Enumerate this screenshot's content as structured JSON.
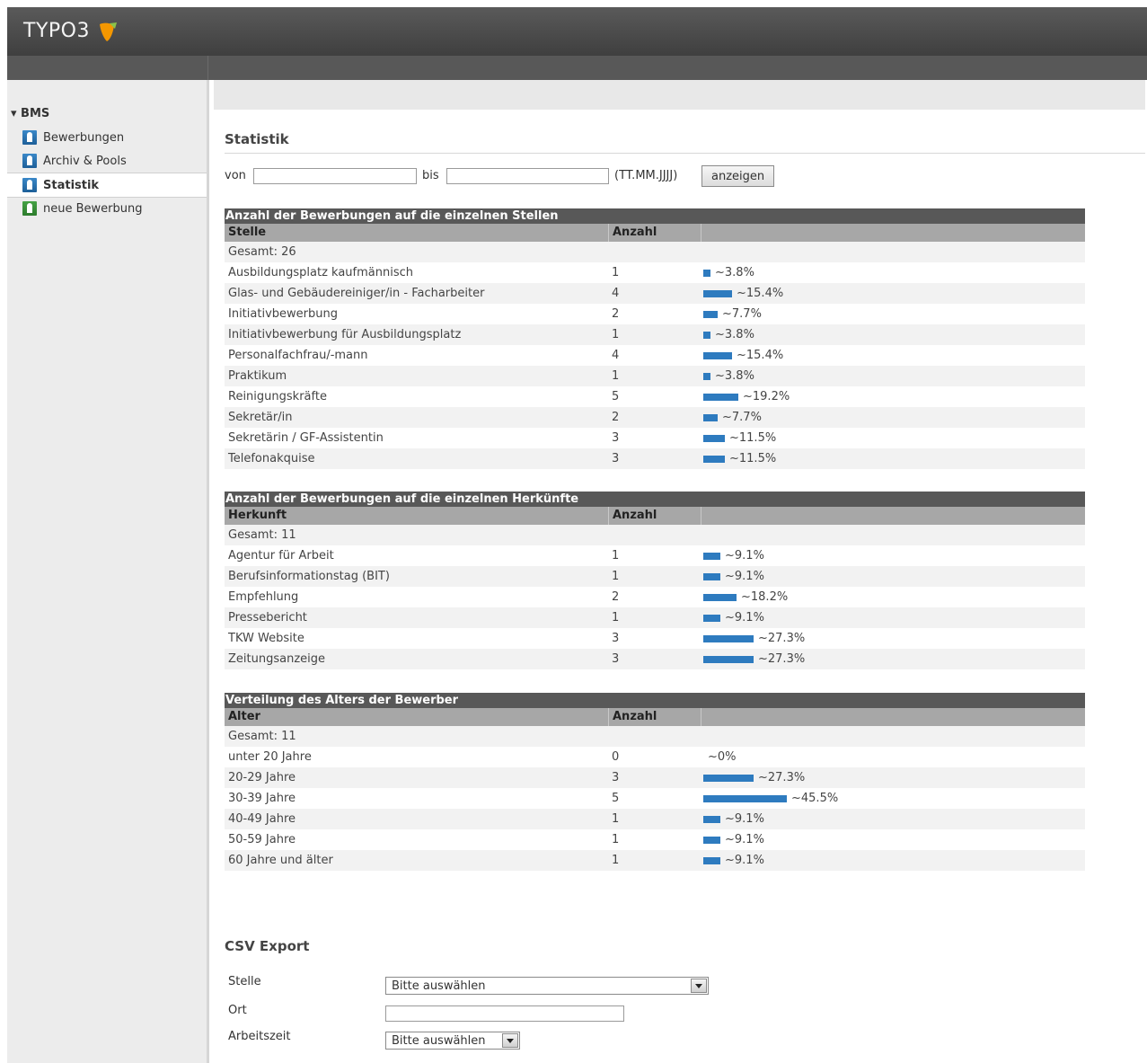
{
  "app": {
    "logo_text": "TYPO3"
  },
  "sidebar": {
    "group": "▾ BMS",
    "items": [
      {
        "label": "Bewerbungen",
        "icon": "user-icon"
      },
      {
        "label": "Archiv & Pools",
        "icon": "archive-user-icon"
      },
      {
        "label": "Statistik",
        "icon": "statistics-icon"
      },
      {
        "label": "neue Bewerbung",
        "icon": "add-user-icon"
      }
    ]
  },
  "main": {
    "title": "Statistik",
    "filter": {
      "from_label": "von",
      "from_value": "",
      "to_label": "bis",
      "to_value": "",
      "format_hint": "(TT.MM.JJJJ)",
      "submit_label": "anzeigen"
    },
    "tables": [
      {
        "title": "Anzahl der Bewerbungen auf die einzelnen Stellen",
        "col1": "Stelle",
        "col2": "Anzahl",
        "total": "Gesamt: 26",
        "rows": [
          {
            "label": "Ausbildungsplatz kaufmännisch",
            "count": "1",
            "pct": "~3.8%",
            "share": 0.038
          },
          {
            "label": "Glas- und Gebäudereiniger/in - Facharbeiter",
            "count": "4",
            "pct": "~15.4%",
            "share": 0.154
          },
          {
            "label": "Initiativbewerbung",
            "count": "2",
            "pct": "~7.7%",
            "share": 0.077
          },
          {
            "label": "Initiativbewerbung für Ausbildungsplatz",
            "count": "1",
            "pct": "~3.8%",
            "share": 0.038
          },
          {
            "label": "Personalfachfrau/-mann",
            "count": "4",
            "pct": "~15.4%",
            "share": 0.154
          },
          {
            "label": "Praktikum",
            "count": "1",
            "pct": "~3.8%",
            "share": 0.038
          },
          {
            "label": "Reinigungskräfte",
            "count": "5",
            "pct": "~19.2%",
            "share": 0.192
          },
          {
            "label": "Sekretär/in",
            "count": "2",
            "pct": "~7.7%",
            "share": 0.077
          },
          {
            "label": "Sekretärin / GF-Assistentin",
            "count": "3",
            "pct": "~11.5%",
            "share": 0.115
          },
          {
            "label": "Telefonakquise",
            "count": "3",
            "pct": "~11.5%",
            "share": 0.115
          }
        ]
      },
      {
        "title": "Anzahl der Bewerbungen auf die einzelnen Herkünfte",
        "col1": "Herkunft",
        "col2": "Anzahl",
        "total": "Gesamt: 11",
        "rows": [
          {
            "label": "Agentur für Arbeit",
            "count": "1",
            "pct": "~9.1%",
            "share": 0.091
          },
          {
            "label": "Berufsinformationstag (BIT)",
            "count": "1",
            "pct": "~9.1%",
            "share": 0.091
          },
          {
            "label": "Empfehlung",
            "count": "2",
            "pct": "~18.2%",
            "share": 0.182
          },
          {
            "label": "Pressebericht",
            "count": "1",
            "pct": "~9.1%",
            "share": 0.091
          },
          {
            "label": "TKW Website",
            "count": "3",
            "pct": "~27.3%",
            "share": 0.273
          },
          {
            "label": "Zeitungsanzeige",
            "count": "3",
            "pct": "~27.3%",
            "share": 0.273
          }
        ]
      },
      {
        "title": "Verteilung des Alters der Bewerber",
        "col1": "Alter",
        "col2": "Anzahl",
        "total": "Gesamt: 11",
        "rows": [
          {
            "label": "unter 20 Jahre",
            "count": "0",
            "pct": "~0%",
            "share": 0
          },
          {
            "label": "20-29 Jahre",
            "count": "3",
            "pct": "~27.3%",
            "share": 0.273
          },
          {
            "label": "30-39 Jahre",
            "count": "5",
            "pct": "~45.5%",
            "share": 0.455
          },
          {
            "label": "40-49 Jahre",
            "count": "1",
            "pct": "~9.1%",
            "share": 0.091
          },
          {
            "label": "50-59 Jahre",
            "count": "1",
            "pct": "~9.1%",
            "share": 0.091
          },
          {
            "label": "60 Jahre und älter",
            "count": "1",
            "pct": "~9.1%",
            "share": 0.091
          }
        ]
      }
    ],
    "csv": {
      "title": "CSV Export",
      "stelle_label": "Stelle",
      "stelle_value": "Bitte auswählen",
      "ort_label": "Ort",
      "ort_value": "",
      "arbeitszeit_label": "Arbeitszeit",
      "arbeitszeit_value": "Bitte auswählen"
    }
  },
  "colors": {
    "bar": "#2e7bbf",
    "header_dark": "#585858",
    "header_gray": "#a7a7a7"
  }
}
